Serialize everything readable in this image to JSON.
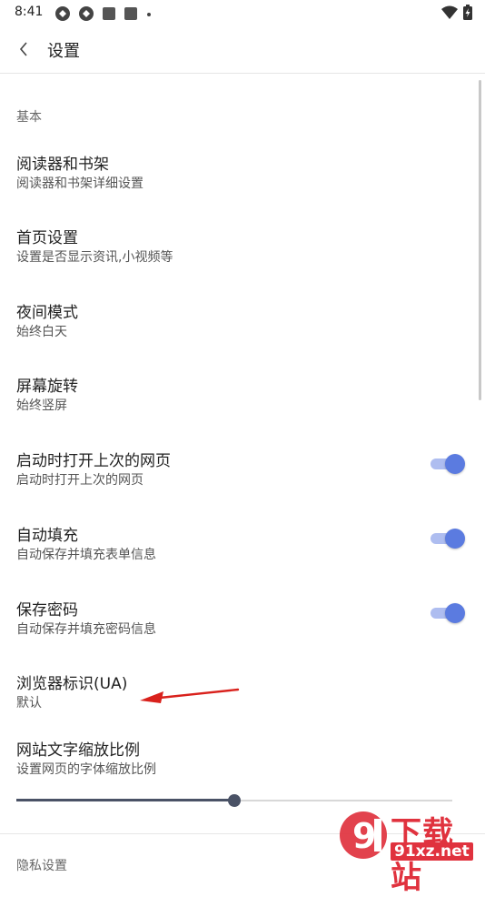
{
  "status_bar": {
    "time": "8:41"
  },
  "header": {
    "title": "设置"
  },
  "section_basic": {
    "label": "基本"
  },
  "items": [
    {
      "title": "阅读器和书架",
      "subtitle": "阅读器和书架详细设置"
    },
    {
      "title": "首页设置",
      "subtitle": "设置是否显示资讯,小视频等"
    },
    {
      "title": "夜间模式",
      "subtitle": "始终白天"
    },
    {
      "title": "屏幕旋转",
      "subtitle": "始终竖屏"
    },
    {
      "title": "启动时打开上次的网页",
      "subtitle": "启动时打开上次的网页",
      "toggle": true
    },
    {
      "title": "自动填充",
      "subtitle": "自动保存并填充表单信息",
      "toggle": true
    },
    {
      "title": "保存密码",
      "subtitle": "自动保存并填充密码信息",
      "toggle": true
    },
    {
      "title": "浏览器标识(UA)",
      "subtitle": "默认"
    },
    {
      "title": "网站文字缩放比例",
      "subtitle": "设置网页的字体缩放比例"
    }
  ],
  "text_scale_slider": {
    "fraction": 0.5
  },
  "next_section": {
    "label": "隐私设置"
  },
  "watermark": {
    "brand": "下载站",
    "url": "91xz.net",
    "logo_text": "9"
  },
  "colors": {
    "accent": "#5b7be0",
    "accent_track": "#aebdf0",
    "slider": "#4a5266",
    "annotation": "#d9211c",
    "watermark": "#e0323e"
  }
}
